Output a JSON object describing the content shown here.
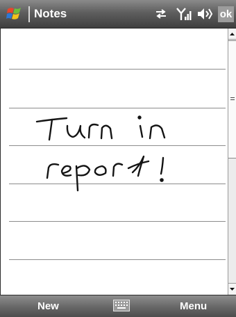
{
  "titlebar": {
    "app_title": "Notes",
    "ok_label": "ok",
    "icons": [
      "windows-start-icon",
      "connectivity-icon",
      "signal-strength-icon",
      "volume-icon"
    ]
  },
  "note": {
    "handwritten_text": "Turn in report!",
    "ink_color": "#141414"
  },
  "menubar": {
    "left_softkey": "New",
    "right_softkey": "Menu",
    "center_icon": "keyboard-icon"
  },
  "colors": {
    "titlebar": "#5e5e5e",
    "menubar": "#6a6a6a",
    "rule_lines": "#8c8c8c"
  }
}
